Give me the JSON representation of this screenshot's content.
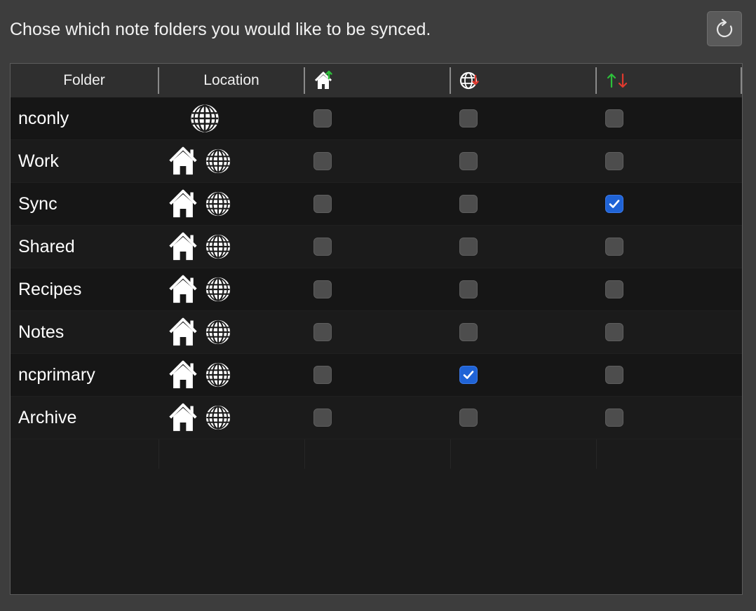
{
  "header": {
    "instruction": "Chose which note folders you would like to be synced."
  },
  "toolbar": {
    "refresh_icon": "refresh-icon"
  },
  "table": {
    "columns": [
      {
        "label": "Folder"
      },
      {
        "label": "Location"
      },
      {
        "icon": "home-up-icon"
      },
      {
        "icon": "globe-down-icon"
      },
      {
        "label": "↑↓",
        "icon": "sync-arrows-icon"
      }
    ],
    "rows": [
      {
        "name": "nconly",
        "location": [
          "globe"
        ],
        "local": false,
        "remote": false,
        "sync": false
      },
      {
        "name": "Work",
        "location": [
          "home",
          "globe"
        ],
        "local": false,
        "remote": false,
        "sync": false
      },
      {
        "name": "Sync",
        "location": [
          "home",
          "globe"
        ],
        "local": false,
        "remote": false,
        "sync": true
      },
      {
        "name": "Shared",
        "location": [
          "home",
          "globe"
        ],
        "local": false,
        "remote": false,
        "sync": false
      },
      {
        "name": "Recipes",
        "location": [
          "home",
          "globe"
        ],
        "local": false,
        "remote": false,
        "sync": false
      },
      {
        "name": "Notes",
        "location": [
          "home",
          "globe"
        ],
        "local": false,
        "remote": false,
        "sync": false
      },
      {
        "name": "ncprimary",
        "location": [
          "home",
          "globe"
        ],
        "local": false,
        "remote": true,
        "sync": false
      },
      {
        "name": "Archive",
        "location": [
          "home",
          "globe"
        ],
        "local": false,
        "remote": false,
        "sync": false
      }
    ]
  },
  "colors": {
    "accent": "#1f63d6",
    "up_arrow": "#2dbf3a",
    "down_arrow": "#e0392e"
  }
}
